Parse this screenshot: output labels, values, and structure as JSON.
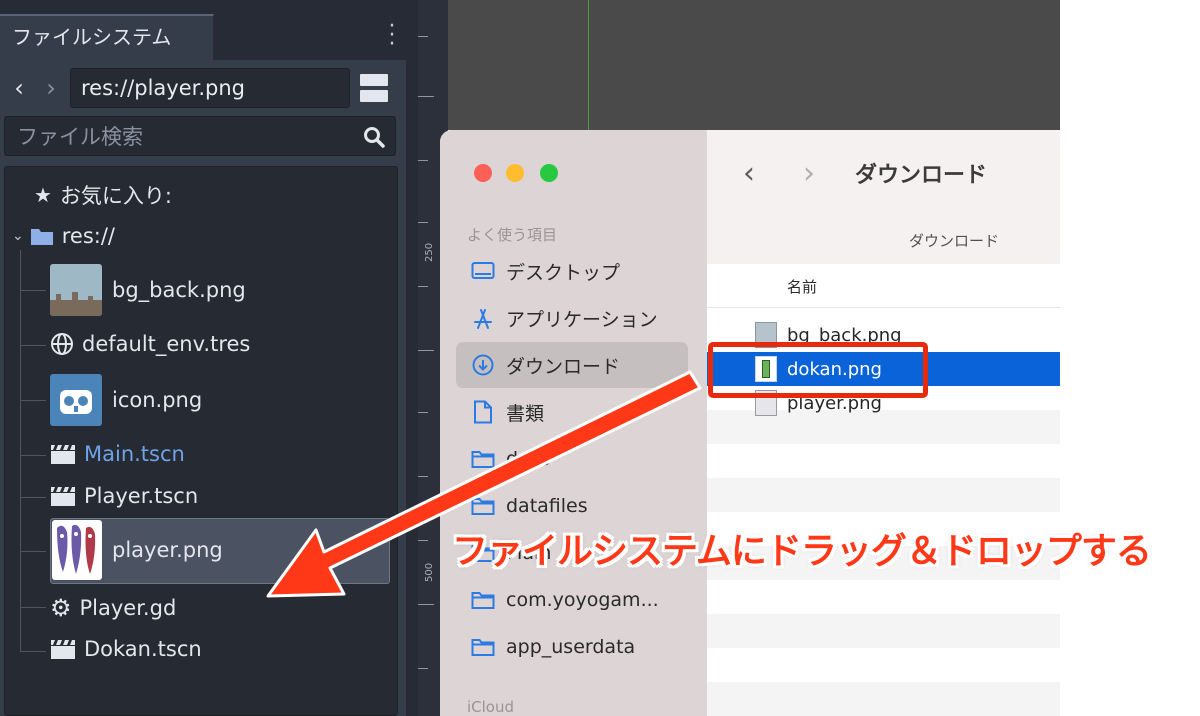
{
  "godot": {
    "tab_title": "ファイルシステム",
    "path_value": "res://player.png",
    "search_placeholder": "ファイル検索",
    "favorites_label": "お気に入り:",
    "root_label": "res://",
    "files": [
      {
        "name": "bg_back.png",
        "icon": "image-thumbnail"
      },
      {
        "name": "default_env.tres",
        "icon": "globe-icon"
      },
      {
        "name": "icon.png",
        "icon": "godot-logo-thumbnail"
      },
      {
        "name": "Main.tscn",
        "icon": "clapperboard-icon",
        "color": "#6fa3e6"
      },
      {
        "name": "Player.tscn",
        "icon": "clapperboard-icon"
      },
      {
        "name": "player.png",
        "icon": "sprite-thumbnail",
        "selected": true
      },
      {
        "name": "Player.gd",
        "icon": "gear-icon"
      },
      {
        "name": "Dokan.tscn",
        "icon": "clapperboard-icon"
      }
    ],
    "ruler_labels": [
      "250",
      "500"
    ]
  },
  "finder": {
    "sidebar_section": "よく使う項目",
    "sidebar_items": [
      "デスクトップ",
      "アプリケーション",
      "ダウンロード",
      "書類",
      "docs",
      "datafiles",
      "Main",
      "com.yoyogam...",
      "app_userdata"
    ],
    "icloud_label": "iCloud",
    "title": "ダウンロード",
    "path_label": "ダウンロード",
    "column_name": "名前",
    "files": [
      "bg_back.png",
      "dokan.png",
      "player.png"
    ],
    "selected_file": "dokan.png"
  },
  "annotation": {
    "text": "ファイルシステムにドラッグ＆ドロップする",
    "color": "#ff3818"
  },
  "colors": {
    "godot_bg": "#363d4a",
    "godot_tree_bg": "#252a33",
    "finder_selection": "#0a63d8",
    "highlight_box": "#e8290c"
  }
}
